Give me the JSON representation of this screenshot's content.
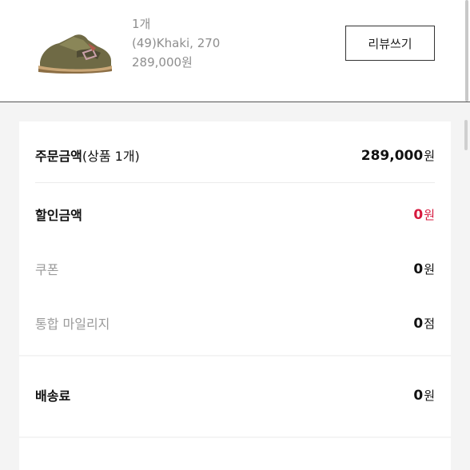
{
  "product": {
    "quantity": "1개",
    "option": "(49)Khaki, 270",
    "price": "289,000원",
    "image_icon": "sneaker-thumbnail"
  },
  "review_button": {
    "label": "리뷰쓰기"
  },
  "summary": {
    "order_amount": {
      "label": "주문금액",
      "sub": "(상품 1개)",
      "value": "289,000",
      "unit": "원"
    },
    "discount": {
      "label": "할인금액",
      "value": "0",
      "unit": "원"
    },
    "coupon": {
      "label": "쿠폰",
      "value": "0",
      "unit": "원"
    },
    "mileage": {
      "label": "통합 마일리지",
      "value": "0",
      "unit": "점"
    }
  },
  "shipping": {
    "label": "배송료",
    "value": "0",
    "unit": "원"
  },
  "colors": {
    "discount_red": "#d6193e",
    "gray_text": "#9a9a9a",
    "page_bg": "#f4f4f4"
  }
}
